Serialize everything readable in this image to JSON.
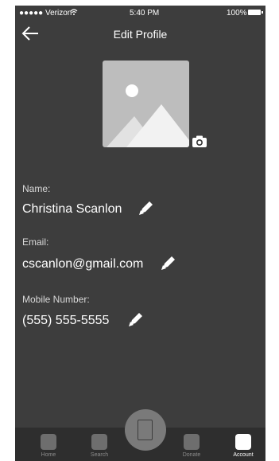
{
  "status_bar": {
    "carrier": "●●●●● Verizon",
    "time": "5:40 PM",
    "battery": "100%"
  },
  "header": {
    "title": "Edit Profile",
    "back_icon": "arrow-left-icon"
  },
  "profile": {
    "photo_icon": "image-placeholder-icon",
    "camera_icon": "camera-icon"
  },
  "fields": {
    "name": {
      "label": "Name:",
      "value": "Christina Scanlon"
    },
    "email": {
      "label": "Email:",
      "value": "cscanlon@gmail.com"
    },
    "mobile": {
      "label": "Mobile Number:",
      "value": "(555) 555-5555"
    },
    "edit_icon": "pencil-icon"
  },
  "tab_bar": {
    "home": "Home",
    "search": "Search",
    "donate": "Donate",
    "account": "Account",
    "active": "account"
  },
  "colors": {
    "background": "#3d3d3d",
    "text": "#ffffff",
    "label": "#d9d9d9",
    "tab_inactive": "#6e6e6e"
  }
}
